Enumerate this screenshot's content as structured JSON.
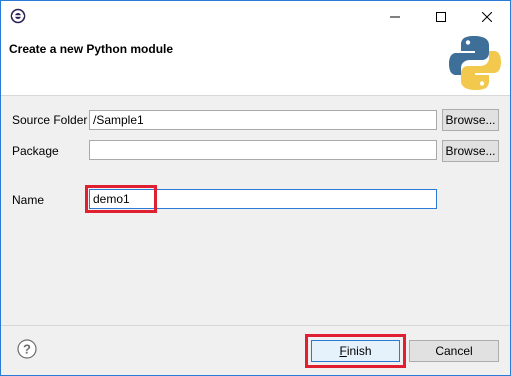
{
  "window": {
    "minimize_icon": "minimize-icon",
    "maximize_icon": "maximize-icon",
    "close_icon": "close-icon"
  },
  "banner": {
    "title": "Create a new Python module",
    "logo_icon": "python-logo-icon"
  },
  "form": {
    "source_folder": {
      "label": "Source Folder",
      "value": "/Sample1",
      "browse_label": "Browse..."
    },
    "package": {
      "label": "Package",
      "value": "",
      "browse_label": "Browse..."
    },
    "name": {
      "label": "Name",
      "value": "demo1"
    }
  },
  "footer": {
    "help_icon": "help-icon",
    "finish_mnemonic": "F",
    "finish_rest": "inish",
    "cancel_label": "Cancel"
  },
  "colors": {
    "highlight": "#e02030",
    "accent": "#2b7bd6",
    "python_blue": "#3e6f99",
    "python_yellow": "#f2c94c"
  }
}
